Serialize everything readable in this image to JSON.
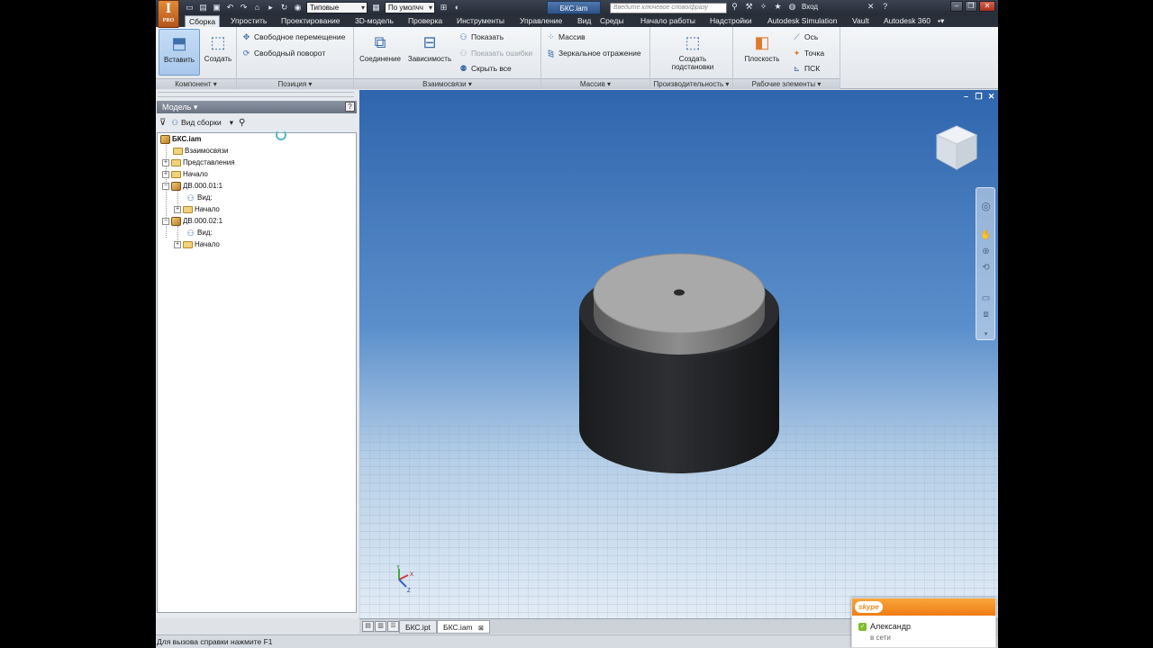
{
  "app": {
    "logo_letter": "I",
    "logo_sub": "PRO"
  },
  "quick_access": {
    "style_combo": "Типовые",
    "view_combo": "По умолчч",
    "doc_tab": "БКС.iam",
    "search_placeholder": "Введите ключевое слово/фразу",
    "signin_label": "Вход"
  },
  "ribbon_tabs": [
    {
      "label": "Сборка",
      "active": true
    },
    {
      "label": "Упростить"
    },
    {
      "label": "Проектирование"
    },
    {
      "label": "3D-модель"
    },
    {
      "label": "Проверка"
    },
    {
      "label": "Инструменты"
    },
    {
      "label": "Управление"
    },
    {
      "label": "Вид"
    },
    {
      "label": "Среды"
    },
    {
      "label": "Начало работы"
    },
    {
      "label": "Надстройки"
    },
    {
      "label": "Autodesk Simulation"
    },
    {
      "label": "Vault"
    },
    {
      "label": "Autodesk 360"
    }
  ],
  "ribbon": {
    "component": {
      "title": "Компонент",
      "insert": "Вставить",
      "create": "Создать"
    },
    "position": {
      "title": "Позиция",
      "free_move": "Свободное перемещение",
      "free_rotate": "Свободный поворот"
    },
    "constraints": {
      "title": "Взаимосвязи",
      "joint": "Соединение",
      "constrain": "Зависимость",
      "show": "Показать",
      "show_errors": "Показать ошибки",
      "hide_all": "Скрыть все"
    },
    "pattern": {
      "title": "Массив",
      "pattern": "Массив",
      "mirror": "Зеркальное отражение"
    },
    "productivity": {
      "title": "Производительность",
      "create_sub_1": "Создать",
      "create_sub_2": "подстановки"
    },
    "work_features": {
      "title": "Рабочие элементы",
      "plane": "Плоскость",
      "axis": "Ось",
      "point": "Точка",
      "ucs": "ПСК"
    }
  },
  "browser": {
    "title": "Модель",
    "help": "?",
    "view_mode": "Вид сборки",
    "tree": [
      {
        "label": "БКС.iam",
        "type": "root"
      },
      {
        "label": "Взаимосвязи",
        "type": "folder"
      },
      {
        "label": "Представления",
        "type": "folder"
      },
      {
        "label": "Начало",
        "type": "folder"
      },
      {
        "label": "ДВ.000.01:1",
        "type": "part"
      },
      {
        "label": "Вид:",
        "type": "view"
      },
      {
        "label": "Начало",
        "type": "folder"
      },
      {
        "label": "ДВ.000.02:1",
        "type": "part"
      },
      {
        "label": "Вид:",
        "type": "view"
      },
      {
        "label": "Начало",
        "type": "folder"
      }
    ]
  },
  "doc_tabs": [
    {
      "label": "БКС.ipt"
    },
    {
      "label": "БКС.iam",
      "active": true
    }
  ],
  "status_text": "Для вызова справки нажмите F1",
  "skype": {
    "logo": "skype",
    "contact_name": "Александр",
    "contact_status": "в сети"
  },
  "colors": {
    "accent": "#3e6fa8",
    "viewport_top": "#2f65ad",
    "skype_orange": "#ee7d14",
    "online_green": "#7cbd2a"
  }
}
